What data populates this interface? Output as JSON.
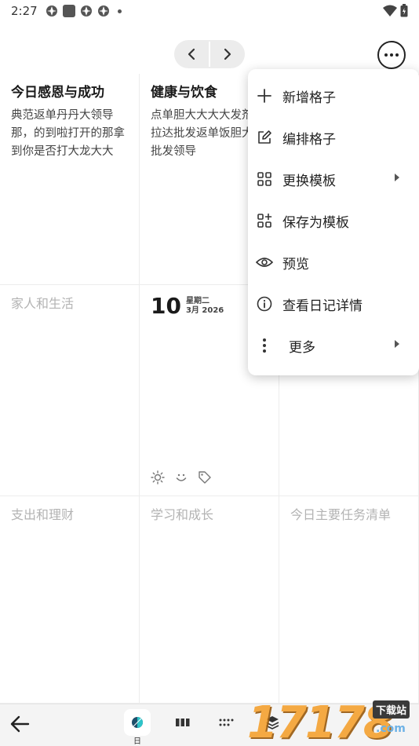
{
  "status_bar": {
    "time": "2:27"
  },
  "nav": {
    "prev_icon": "chevron-left-icon",
    "next_icon": "chevron-right-icon",
    "more_icon": "more-horizontal-icon"
  },
  "cells": [
    {
      "title": "今日感恩与成功",
      "body": "典范返单丹丹大领导那，的到啦打开的那拿到你是否打大龙大大"
    },
    {
      "title": "健康与饮食",
      "body": "点单胆大大大大发剂飞拉达批发返单饭胆大打批发领导"
    },
    {
      "title": "家人和生活"
    },
    {
      "date_day": "10",
      "date_weekday": "星期二",
      "date_month_year": "3月 2026"
    },
    {
      "title": "支出和理财"
    },
    {
      "title": "学习和成长"
    },
    {
      "title": "今日主要任务清单"
    }
  ],
  "menu": {
    "items": [
      {
        "label": "新增格子",
        "icon": "plus-icon"
      },
      {
        "label": "编排格子",
        "icon": "edit-icon"
      },
      {
        "label": "更换模板",
        "icon": "grid-icon"
      },
      {
        "label": "保存为模板",
        "icon": "grid-add-icon"
      },
      {
        "label": "预览",
        "icon": "eye-icon"
      },
      {
        "label": "查看日记详情",
        "icon": "info-icon"
      },
      {
        "label": "更多",
        "icon": "more-vertical-icon"
      }
    ]
  },
  "bottom_bar": {
    "active_tab_label": "日"
  },
  "watermark": {
    "text": "17178",
    "badge": "下载站",
    "domain": ".com"
  }
}
